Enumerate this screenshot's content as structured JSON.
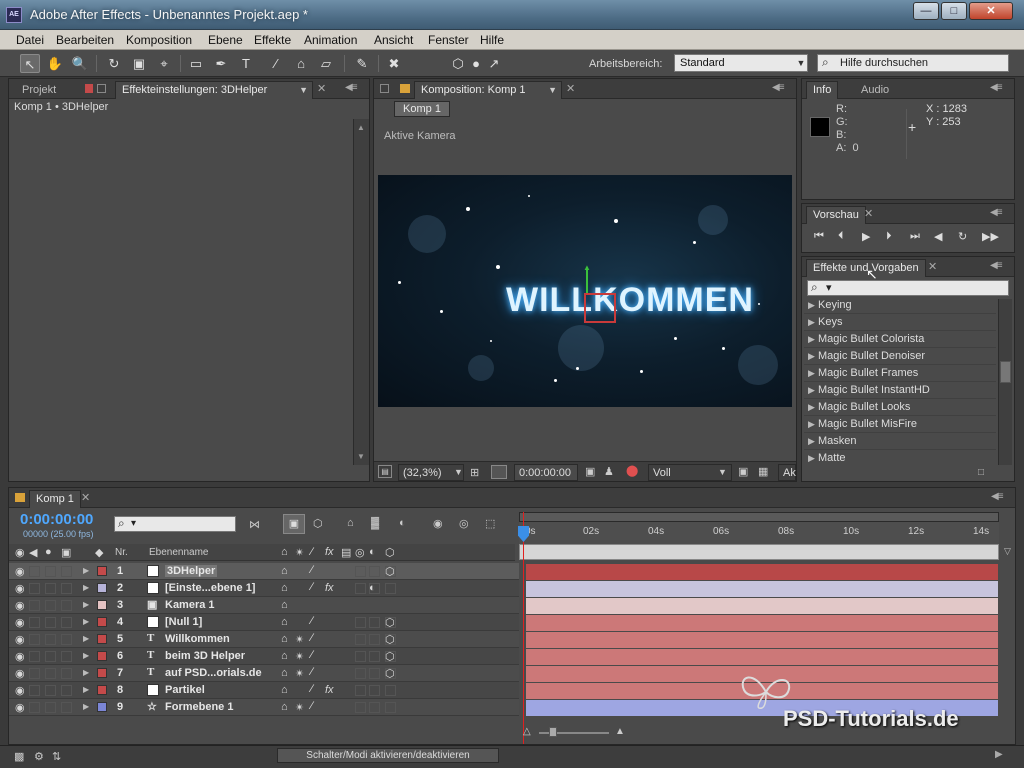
{
  "window": {
    "title": "Adobe After Effects - Unbenanntes Projekt.aep *",
    "app_icon": "AE",
    "buttons": {
      "minimize": "—",
      "maximize": "□",
      "close": "✕"
    }
  },
  "menu": [
    "Datei",
    "Bearbeiten",
    "Komposition",
    "Ebene",
    "Effekte",
    "Animation",
    "Ansicht",
    "Fenster",
    "Hilfe"
  ],
  "toolbar": {
    "workspace_label": "Arbeitsbereich:",
    "workspace_value": "Standard",
    "help_placeholder": "Hilfe durchsuchen"
  },
  "project_panel": {
    "tab_project": "Projekt",
    "tab_effects": "Effekteinstellungen: 3DHelper",
    "breadcrumb": "Komp 1 • 3DHelper"
  },
  "comp_panel": {
    "tab": "Komposition: Komp 1",
    "comp_button": "Komp 1",
    "camera_label": "Aktive Kamera",
    "title_text": "WILLKOMMEN",
    "zoom": "(32,3%)",
    "timecode": "0:00:00:00",
    "resolution": "Voll",
    "view": "Ak"
  },
  "info_panel": {
    "tab_info": "Info",
    "tab_audio": "Audio",
    "r": "R:",
    "g": "G:",
    "b": "B:",
    "a": "A:",
    "a_value": "0",
    "x": "X : 1283",
    "y": "Y : 253"
  },
  "preview_panel": {
    "tab": "Vorschau"
  },
  "effects_panel": {
    "tab": "Effekte und Vorgaben",
    "search": "▾",
    "items": [
      "Keying",
      "Keys",
      "Magic Bullet Colorista",
      "Magic Bullet Denoiser",
      "Magic Bullet Frames",
      "Magic Bullet InstantHD",
      "Magic Bullet Looks",
      "Magic Bullet MisFire",
      "Masken",
      "Matte"
    ]
  },
  "timeline": {
    "tab": "Komp 1",
    "timecode": "0:00:00:00",
    "fps": "00000 (25.00 fps)",
    "search": "▾",
    "col_nr": "Nr.",
    "col_name": "Ebenenname",
    "ruler": [
      "0s",
      "02s",
      "04s",
      "06s",
      "08s",
      "10s",
      "12s",
      "14s"
    ],
    "layers": [
      {
        "nr": "1",
        "name": "3DHelper",
        "type": "solid",
        "color": "#c44a4a",
        "bar": "#b84848",
        "swatch": "#ffffff",
        "selected": true
      },
      {
        "nr": "2",
        "name": "[Einste...ebene 1]",
        "type": "solid",
        "color": "#b6b3d8",
        "bar": "#c7c4dd",
        "swatch": "#ffffff",
        "selected": false
      },
      {
        "nr": "3",
        "name": "Kamera 1",
        "type": "camera",
        "color": "#e6c4c4",
        "bar": "#e2c8c8",
        "swatch": "",
        "selected": false
      },
      {
        "nr": "4",
        "name": "[Null 1]",
        "type": "solid",
        "color": "#c44a4a",
        "bar": "#cc7878",
        "swatch": "#ffffff",
        "selected": false
      },
      {
        "nr": "5",
        "name": "Willkommen",
        "type": "text",
        "color": "#c44a4a",
        "bar": "#cc7878",
        "swatch": "",
        "selected": false
      },
      {
        "nr": "6",
        "name": "beim 3D Helper",
        "type": "text",
        "color": "#c44a4a",
        "bar": "#cc7878",
        "swatch": "",
        "selected": false
      },
      {
        "nr": "7",
        "name": "auf PSD...orials.de",
        "type": "text",
        "color": "#c44a4a",
        "bar": "#cc7878",
        "swatch": "",
        "selected": false
      },
      {
        "nr": "8",
        "name": "Partikel",
        "type": "solid",
        "color": "#c44a4a",
        "bar": "#cc7878",
        "swatch": "#ffffff",
        "selected": false
      },
      {
        "nr": "9",
        "name": "Formebene 1",
        "type": "shape",
        "color": "#7b86d6",
        "bar": "#9ea6e2",
        "swatch": "",
        "selected": false
      }
    ],
    "toggle_label": "Schalter/Modi aktivieren/deaktivieren"
  },
  "watermark": "PSD-Tutorials.de"
}
